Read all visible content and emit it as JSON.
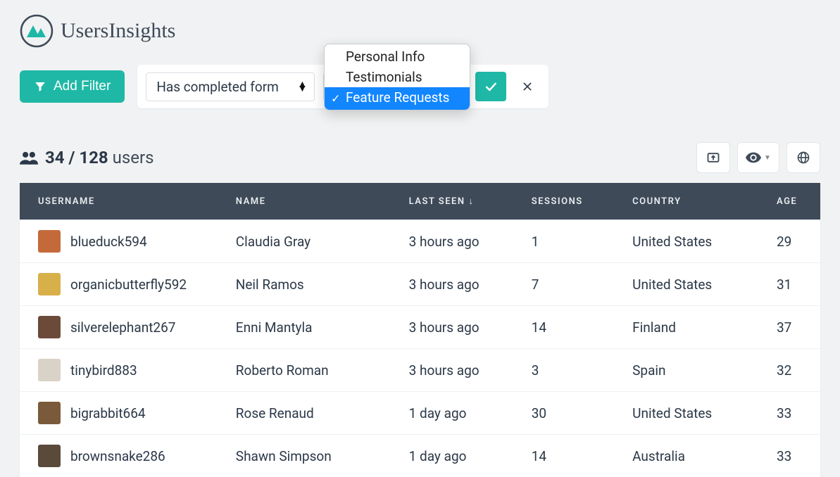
{
  "brand": {
    "name": "UsersInsights"
  },
  "toolbar": {
    "add_filter_label": "Add Filter",
    "filter_type_label": "Has completed form",
    "filter_value_label": "Feature Requests"
  },
  "dropdown": {
    "items": [
      {
        "label": "Personal Info",
        "selected": false
      },
      {
        "label": "Testimonials",
        "selected": false
      },
      {
        "label": "Feature Requests",
        "selected": true
      }
    ]
  },
  "stats": {
    "filtered": "34",
    "separator": " / ",
    "total": "128",
    "label": "users"
  },
  "table": {
    "headers": {
      "username": "USERNAME",
      "name": "NAME",
      "last_seen": "LAST SEEN ↓",
      "sessions": "SESSIONS",
      "country": "COUNTRY",
      "age": "AGE"
    },
    "rows": [
      {
        "avatar_color": "#c46a3a",
        "username": "blueduck594",
        "name": "Claudia Gray",
        "last_seen": "3 hours ago",
        "sessions": "1",
        "country": "United States",
        "age": "29"
      },
      {
        "avatar_color": "#d8b04a",
        "username": "organicbutterfly592",
        "name": "Neil Ramos",
        "last_seen": "3 hours ago",
        "sessions": "7",
        "country": "United States",
        "age": "31"
      },
      {
        "avatar_color": "#6b4a3a",
        "username": "silverelephant267",
        "name": "Enni Mantyla",
        "last_seen": "3 hours ago",
        "sessions": "14",
        "country": "Finland",
        "age": "37"
      },
      {
        "avatar_color": "#d9d2c6",
        "username": "tinybird883",
        "name": "Roberto Roman",
        "last_seen": "3 hours ago",
        "sessions": "3",
        "country": "Spain",
        "age": "32"
      },
      {
        "avatar_color": "#7a5a3a",
        "username": "bigrabbit664",
        "name": "Rose Renaud",
        "last_seen": "1 day ago",
        "sessions": "30",
        "country": "United States",
        "age": "33"
      },
      {
        "avatar_color": "#5a4a3a",
        "username": "brownsnake286",
        "name": "Shawn Simpson",
        "last_seen": "1 day ago",
        "sessions": "14",
        "country": "Australia",
        "age": "33"
      }
    ]
  }
}
